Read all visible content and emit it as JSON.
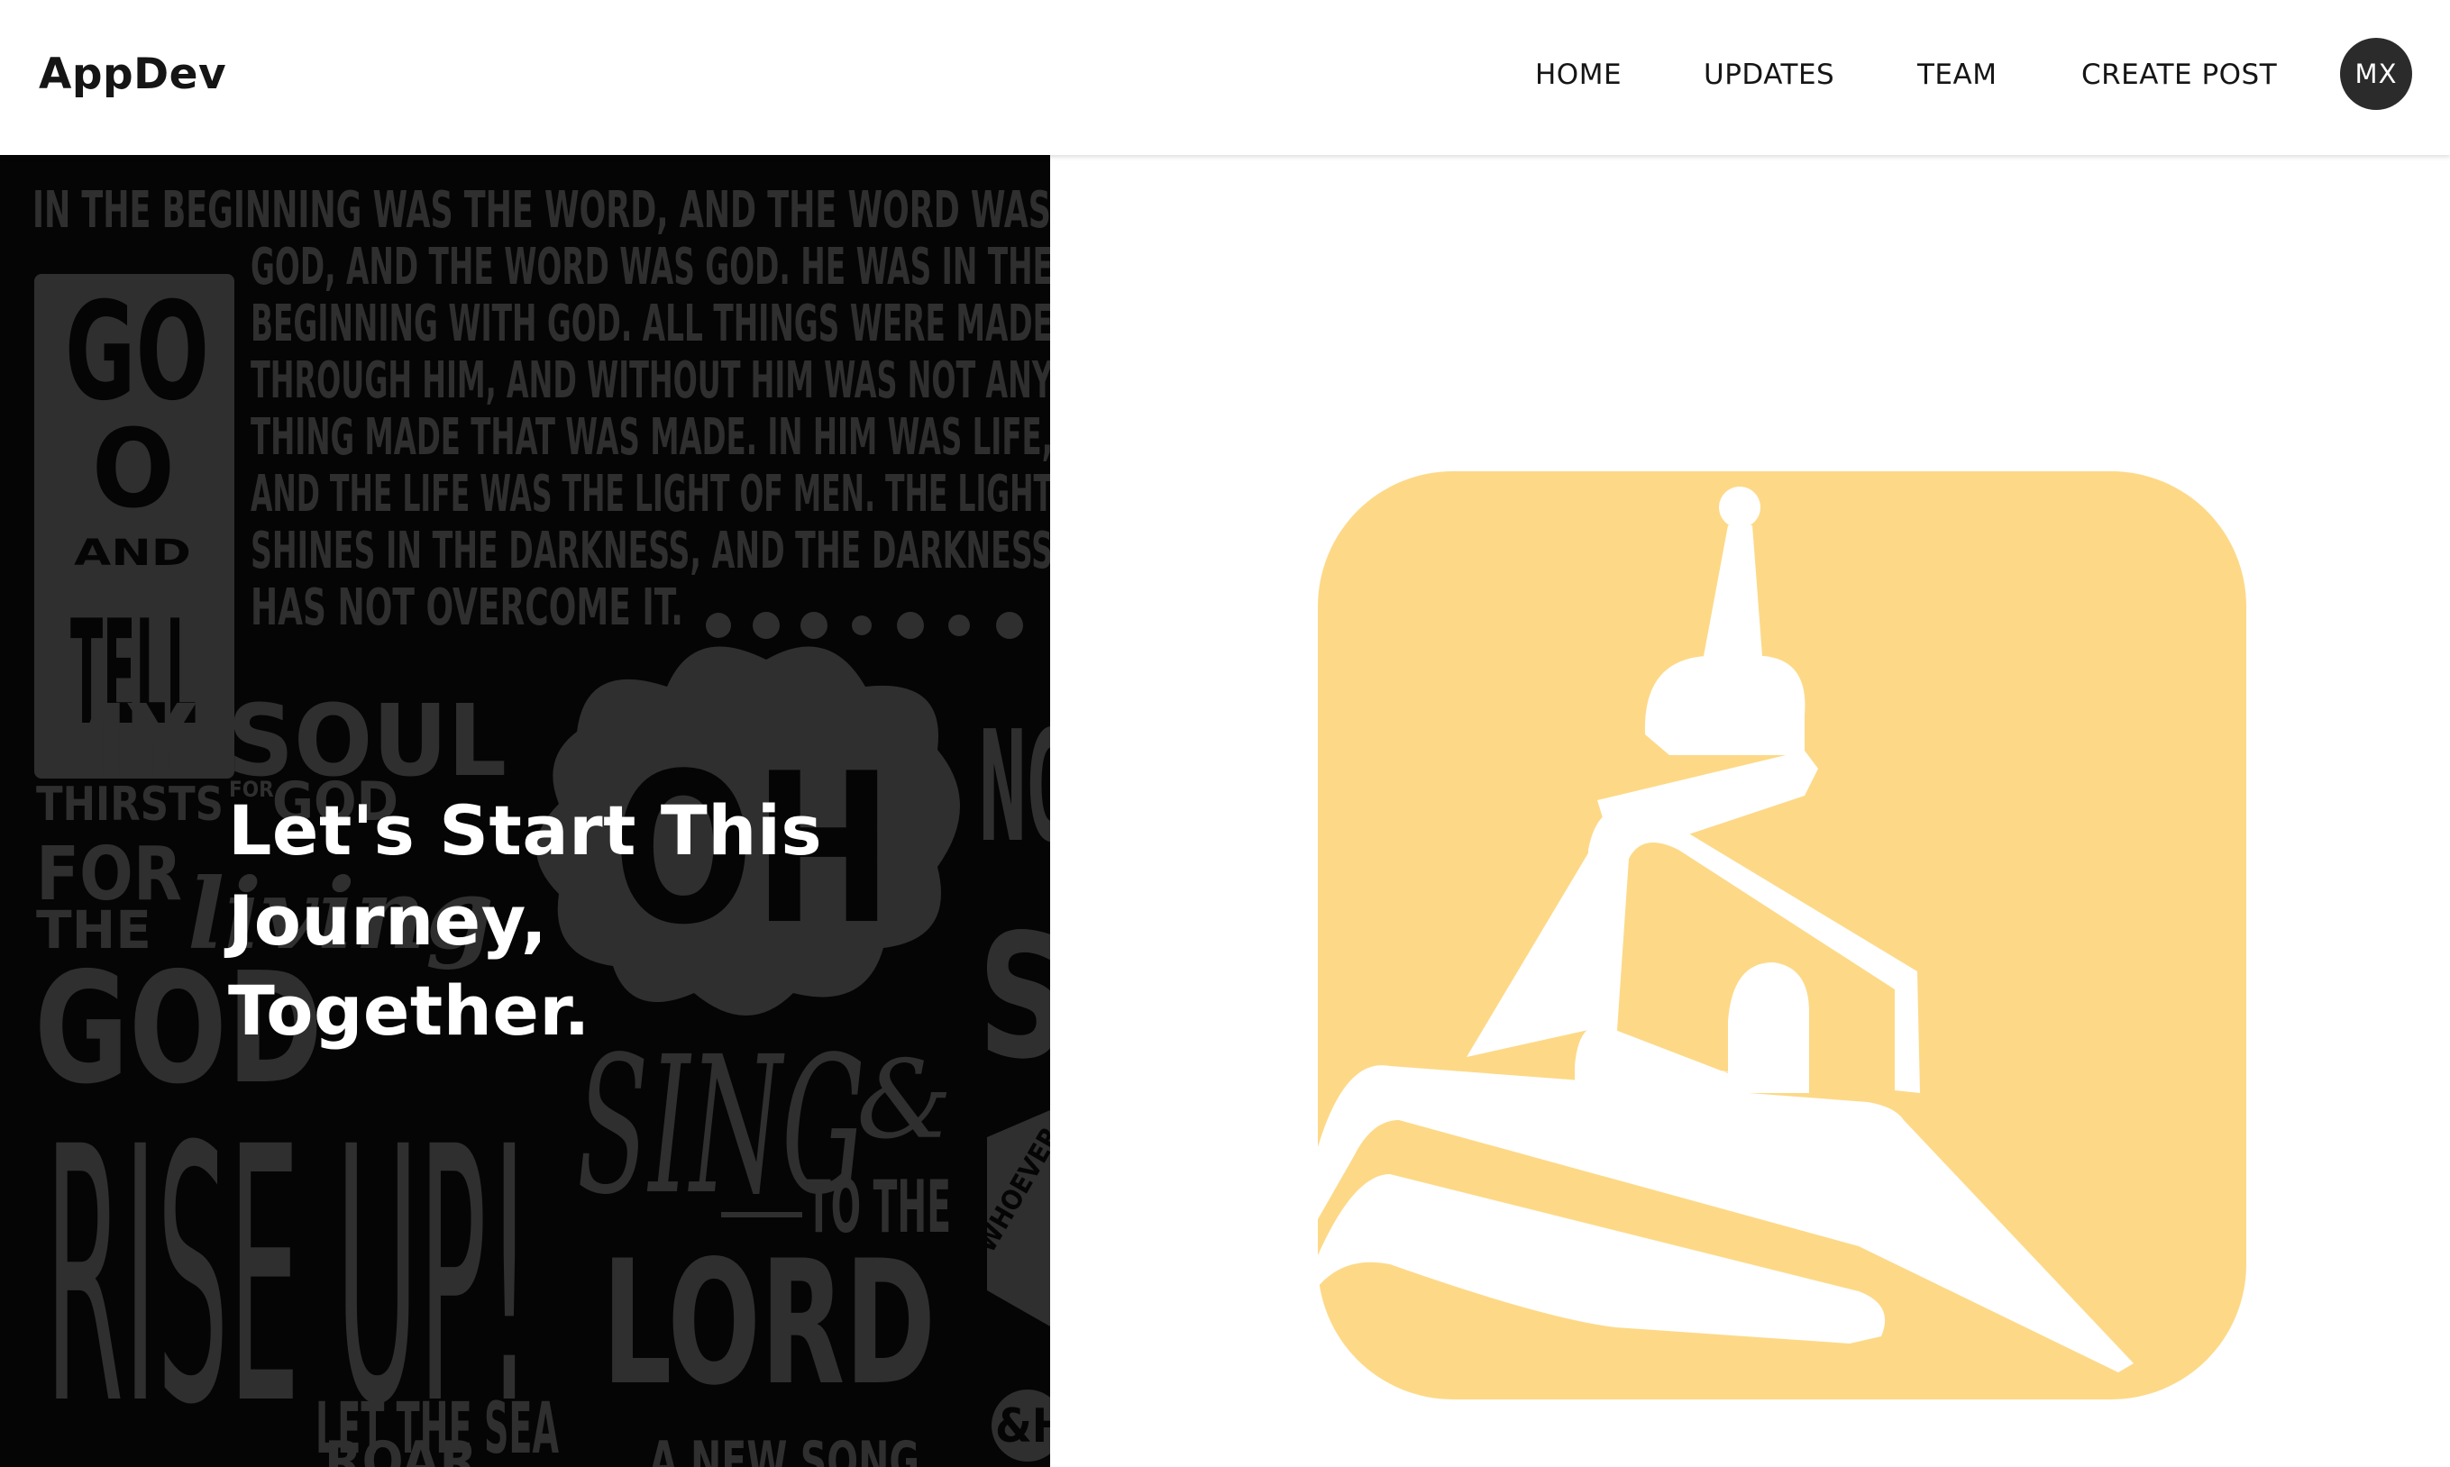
{
  "navbar": {
    "brand": "AppDev",
    "links": [
      "HOME",
      "UPDATES",
      "TEAM",
      "CREATE POST"
    ],
    "avatar_initials": "MX"
  },
  "hero": {
    "title_lines": [
      "Let's Start This",
      "Journey,",
      "Together."
    ]
  },
  "background_lettering": {
    "verse_lines": [
      "IN THE BEGINNING WAS THE WORD, AND THE WORD WAS",
      "GOD, AND THE WORD WAS GOD. HE WAS IN THE",
      "BEGINNING WITH GOD. ALL THINGS WERE MADE",
      "THROUGH HIM, AND WITHOUT HIM WAS NOT ANY",
      "THING MADE THAT WAS MADE. IN HIM WAS LIFE,",
      "AND THE LIFE WAS THE LIGHT OF MEN. THE LIGHT",
      "SHINES IN THE DARKNESS, AND THE DARKNESS",
      "HAS NOT OVERCOME IT."
    ],
    "go": "GO",
    "o": "O",
    "and": "AND",
    "tell": "TELL",
    "my_soul": "MY SOUL",
    "thirsts": "THIRSTS",
    "for_small": "FOR",
    "god_small": "GOD",
    "for_big": "FOR",
    "the_big": "THE",
    "living": "living",
    "god_big": "GOD",
    "oh": "OH",
    "no": "NO",
    "s": "S",
    "rise_up": "RISE UP!",
    "sing": "SING",
    "and_sym": "&",
    "to_the": "TO THE",
    "lord": "LORD",
    "let_the_sea": "LET THE SEA",
    "roar": "ROAR",
    "a_new_song": "A NEW SONG",
    "whoever": "WHOEVER",
    "amp_h": "&H"
  },
  "colors": {
    "logo_yellow": "#fdd987",
    "lettering_gray": "#2f2f2f",
    "panel_black": "#050505",
    "avatar_bg": "#2b2b2b"
  },
  "icons": {
    "church_logo": "church-steeple-logo"
  }
}
